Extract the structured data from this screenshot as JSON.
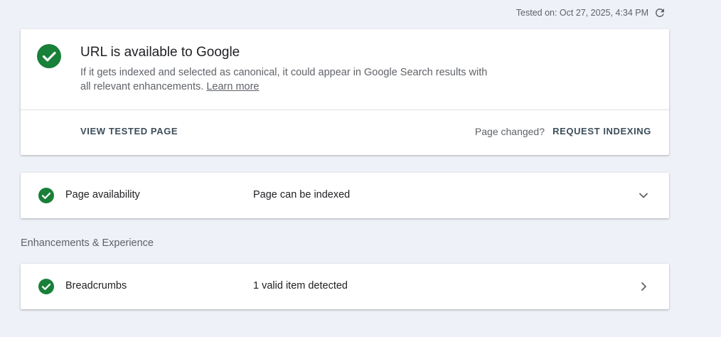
{
  "header": {
    "tested_on": "Tested on: Oct 27, 2025, 4:34 PM",
    "refresh_icon": "refresh-icon"
  },
  "summary": {
    "status_icon": "check-circle-icon",
    "title": "URL is available to Google",
    "description": "If it gets indexed and selected as canonical, it could appear in Google Search results with all relevant enhancements.",
    "learn_more": "Learn more",
    "view_tested_page": "VIEW TESTED PAGE",
    "page_changed": "Page changed?",
    "request_indexing": "REQUEST INDEXING"
  },
  "page_availability": {
    "label": "Page availability",
    "value": "Page can be indexed",
    "expand_icon": "chevron-down-icon"
  },
  "enhancements": {
    "heading": "Enhancements & Experience",
    "items": [
      {
        "label": "Breadcrumbs",
        "value": "1 valid item detected",
        "icon": "chevron-right-icon"
      }
    ]
  },
  "colors": {
    "success_green": "#188038",
    "background": "#eef1f7",
    "action_text": "#3c4e5a"
  }
}
